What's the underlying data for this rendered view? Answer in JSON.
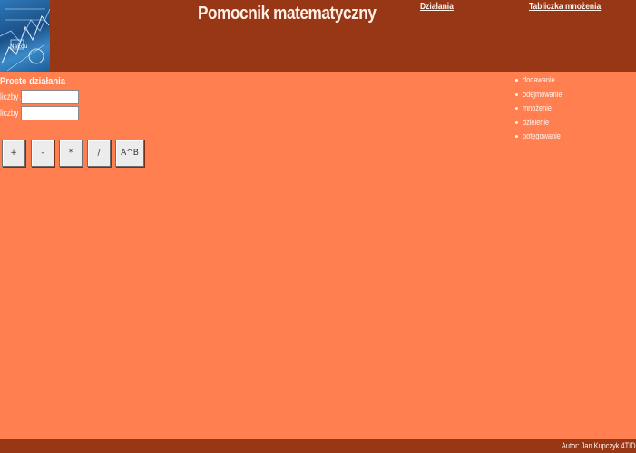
{
  "header": {
    "title": "Pomocnik matematyczny",
    "nav": [
      {
        "label": "Działania"
      },
      {
        "label": "Tabliczka mnożenia"
      }
    ],
    "logo": {
      "icon": "math-collage-logo",
      "text": "NaEdu"
    }
  },
  "form": {
    "title": "Proste działania",
    "label_a": "liczby A:",
    "label_b": "liczby B:",
    "value_a": "",
    "value_b": ""
  },
  "buttons": [
    {
      "label": "+"
    },
    {
      "label": "-"
    },
    {
      "label": "*"
    },
    {
      "label": "/"
    },
    {
      "label": "A^B"
    }
  ],
  "side_menu": [
    {
      "label": "dodawanie"
    },
    {
      "label": "odejmowanie"
    },
    {
      "label": "mnożenie"
    },
    {
      "label": "dzielenie"
    },
    {
      "label": "potęgowanie"
    }
  ],
  "footer": {
    "author": "Autor: Jan Kupczyk 4TID"
  },
  "colors": {
    "background": "#ff7f50",
    "header": "#983716",
    "text": "#fff5ee",
    "button": "#ececec"
  }
}
